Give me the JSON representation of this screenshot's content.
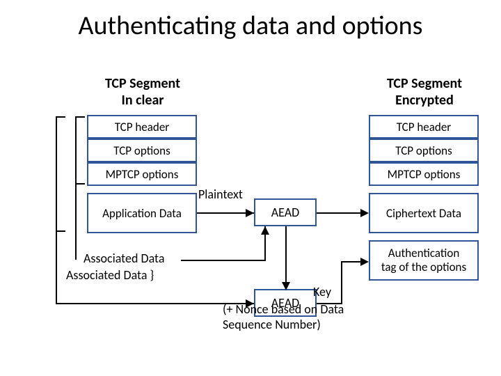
{
  "title": "Authenticating data and options",
  "left": {
    "title_line1": "TCP Segment",
    "title_line2": "In clear",
    "rows": {
      "r0": "TCP header",
      "r1": "TCP options",
      "r2": "MPTCP options",
      "r3": "Application Data"
    }
  },
  "right": {
    "title_line1": "TCP Segment",
    "title_line2": "Encrypted",
    "rows": {
      "r0": "TCP header",
      "r1": "TCP options",
      "r2": "MPTCP options",
      "r3": "Ciphertext Data",
      "r4_line1": "Authentication",
      "r4_line2": "tag of the options"
    }
  },
  "labels": {
    "plaintext": "Plaintext",
    "aead": "AEAD",
    "assoc1": "Associated Data",
    "assoc2": "Associated Data",
    "key_brace": "}",
    "key_line1": "Key",
    "key_line2": "(+ Nonce based on Data",
    "key_line3": "Sequence Number)"
  }
}
